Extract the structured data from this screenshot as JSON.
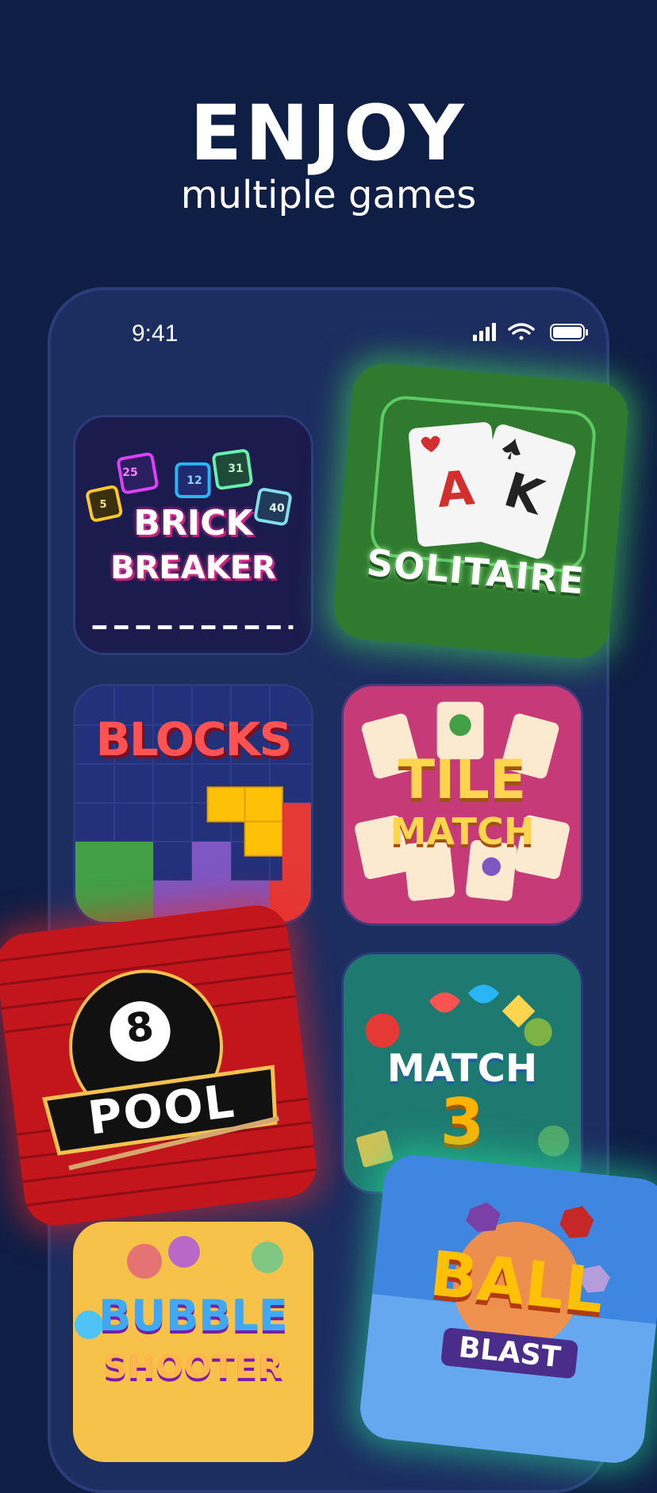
{
  "hero": {
    "title": "ENJOY",
    "subtitle": "multiple games"
  },
  "status_bar": {
    "time": "9:41",
    "icons": [
      "signal-icon",
      "wifi-icon",
      "battery-icon"
    ]
  },
  "games": {
    "brick_breaker": {
      "line1": "BRICK",
      "line2": "BREAKER",
      "blocks": [
        "25",
        "12",
        "31",
        "5",
        "40"
      ]
    },
    "solitaire": {
      "title": "SOLITAIRE",
      "card1": "A",
      "card2": "K"
    },
    "blocks": {
      "title": "BLOCKS"
    },
    "tile_match": {
      "line1": "TILE",
      "line2": "MATCH"
    },
    "pool": {
      "ball_number": "8",
      "title": "POOL"
    },
    "match3": {
      "line1": "MATCH",
      "line2": "3"
    },
    "bubble_shooter": {
      "line1": "BUBBLE",
      "line2": "SHOOTER"
    },
    "ball_blast": {
      "line1": "BALL",
      "line2": "BLAST"
    }
  },
  "colors": {
    "background": "#0f1e45",
    "phone": "#1c2d60",
    "solitaire_glow": "#46e65a",
    "pool_glow": "#e62828",
    "ball_blast_glow": "#28e6a0"
  }
}
